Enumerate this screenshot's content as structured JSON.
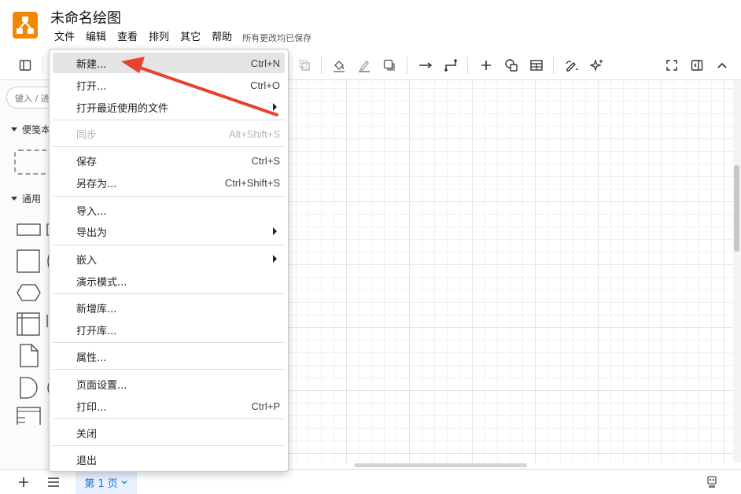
{
  "app": {
    "title": "未命名绘图",
    "brand_color": "#f08705",
    "save_status": "所有更改均已保存"
  },
  "menubar": {
    "items": [
      "文件",
      "编辑",
      "查看",
      "排列",
      "其它",
      "帮助"
    ]
  },
  "toolbar": {
    "icons": [
      "sidebar-toggle-icon",
      "duplicate-icon",
      "fill-color-icon",
      "line-color-icon",
      "shadow-icon",
      "connector-straight-icon",
      "waypoint-icon",
      "insert-icon",
      "shapes-icon",
      "table-icon",
      "freehand-icon",
      "ai-sparkle-icon",
      "fullscreen-icon",
      "format-panel-icon",
      "collapse-icon"
    ]
  },
  "sidebar": {
    "search_placeholder": "键入 / 进",
    "sections": [
      {
        "label": "便笺本"
      },
      {
        "label": "通用"
      }
    ]
  },
  "file_menu": {
    "items": [
      {
        "label": "新建...",
        "shortcut": "Ctrl+N",
        "highlighted": true
      },
      {
        "label": "打开...",
        "shortcut": "Ctrl+O"
      },
      {
        "label": "打开最近使用的文件",
        "shortcut": "",
        "submenu": true
      },
      {
        "label": "同步",
        "shortcut": "Alt+Shift+S",
        "disabled": true
      },
      {
        "label": "保存",
        "shortcut": "Ctrl+S"
      },
      {
        "label": "另存为...",
        "shortcut": "Ctrl+Shift+S"
      },
      {
        "label": "导入...",
        "shortcut": ""
      },
      {
        "label": "导出为",
        "shortcut": "",
        "submenu": true
      },
      {
        "label": "嵌入",
        "shortcut": "",
        "submenu": true
      },
      {
        "label": "演示模式...",
        "shortcut": ""
      },
      {
        "label": "新增库...",
        "shortcut": ""
      },
      {
        "label": "打开库...",
        "shortcut": ""
      },
      {
        "label": "属性...",
        "shortcut": ""
      },
      {
        "label": "页面设置...",
        "shortcut": ""
      },
      {
        "label": "打印...",
        "shortcut": "Ctrl+P"
      },
      {
        "label": "关闭",
        "shortcut": ""
      },
      {
        "label": "退出",
        "shortcut": ""
      }
    ]
  },
  "annotation": {
    "color": "#e8412c"
  },
  "bottombar": {
    "page_tab": "第 1 页"
  }
}
